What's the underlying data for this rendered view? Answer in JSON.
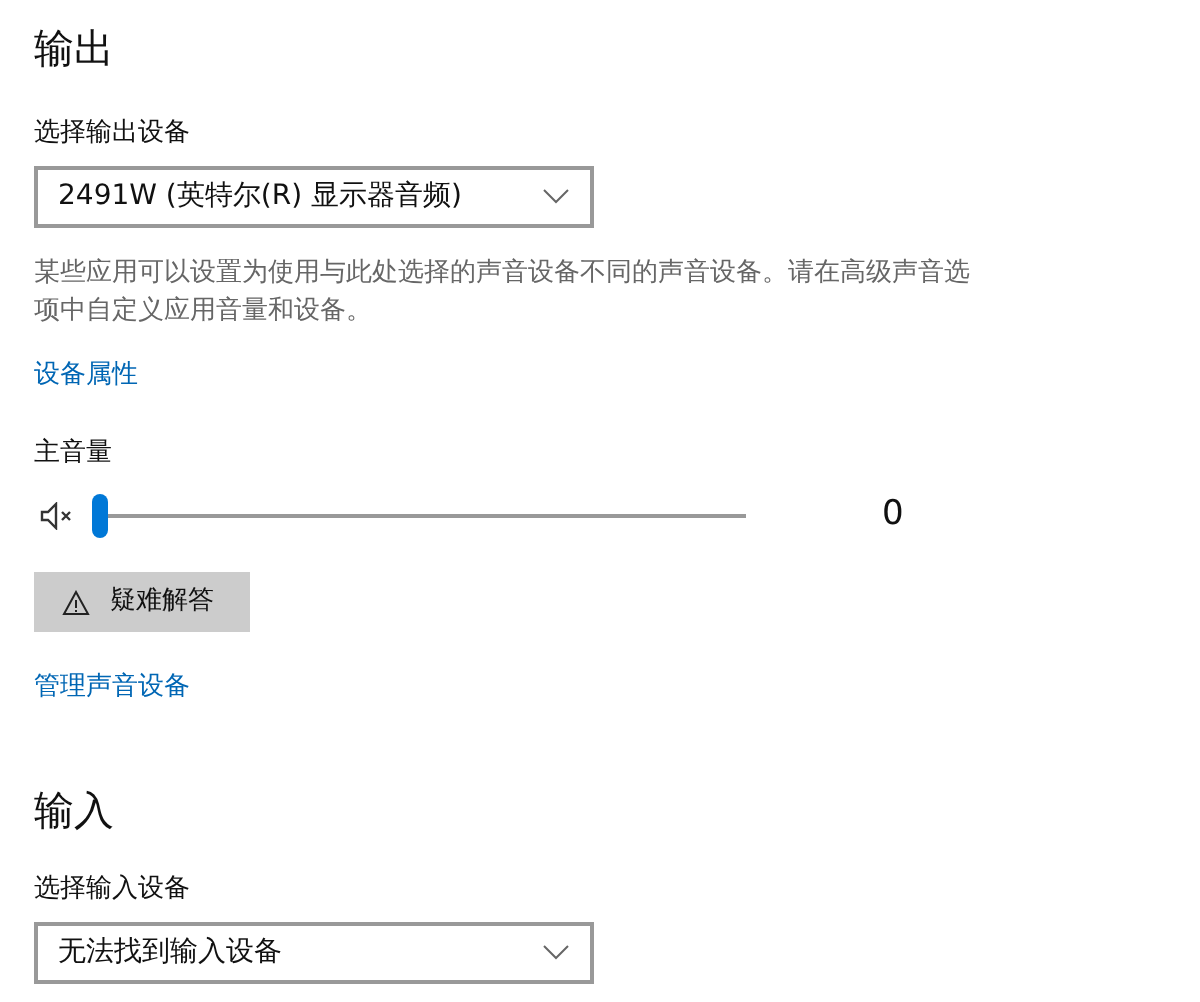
{
  "output": {
    "heading": "输出",
    "device_label": "选择输出设备",
    "device": {
      "value": "2491W (英特尔(R) 显示器音频)"
    },
    "description": "某些应用可以设置为使用与此处选择的声音设备不同的声音设备。请在高级声音选项中自定义应用音量和设备。",
    "properties_link": "设备属性",
    "volume_label": "主音量",
    "volume": {
      "muted": true,
      "level": 0,
      "reading": "0"
    },
    "troubleshoot_button": "疑难解答",
    "manage_link": "管理声音设备"
  },
  "input": {
    "heading": "输入",
    "device_label": "选择输入设备",
    "device": {
      "value": "无法找到输入设备"
    }
  }
}
